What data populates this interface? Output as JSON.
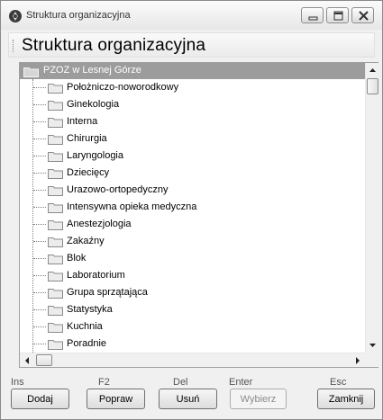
{
  "window": {
    "title": "Struktura organizacyjna",
    "header_title": "Struktura organizacyjna"
  },
  "tree": {
    "root": "PZOZ w Lesnej Górze",
    "children": [
      "Położniczo-noworodkowy",
      "Ginekologia",
      "Interna",
      "Chirurgia",
      "Laryngologia",
      "Dziecięcy",
      "Urazowo-ortopedyczny",
      "Intensywna opieka medyczna",
      "Anestezjologia",
      "Zakaźny",
      "Blok",
      "Laboratorium",
      "Grupa sprzątająca",
      "Statystyka",
      "Kuchnia",
      "Poradnie"
    ]
  },
  "footer": {
    "keys": {
      "add": "Ins",
      "edit": "F2",
      "delete": "Del",
      "select": "Enter",
      "close": "Esc"
    },
    "buttons": {
      "add": "Dodaj",
      "edit": "Popraw",
      "delete": "Usuń",
      "select": "Wybierz",
      "close": "Zamknij"
    }
  },
  "colors": {
    "selected_row_bg": "#9c9c9c",
    "selected_row_text": "#ffffff",
    "folder_fill": "#ececec",
    "folder_stroke": "#8a8a8a"
  },
  "icons": {
    "app": "org-structure-icon",
    "folder": "folder-icon",
    "minimize": "minimize-icon",
    "maximize": "maximize-icon",
    "close": "close-icon"
  }
}
